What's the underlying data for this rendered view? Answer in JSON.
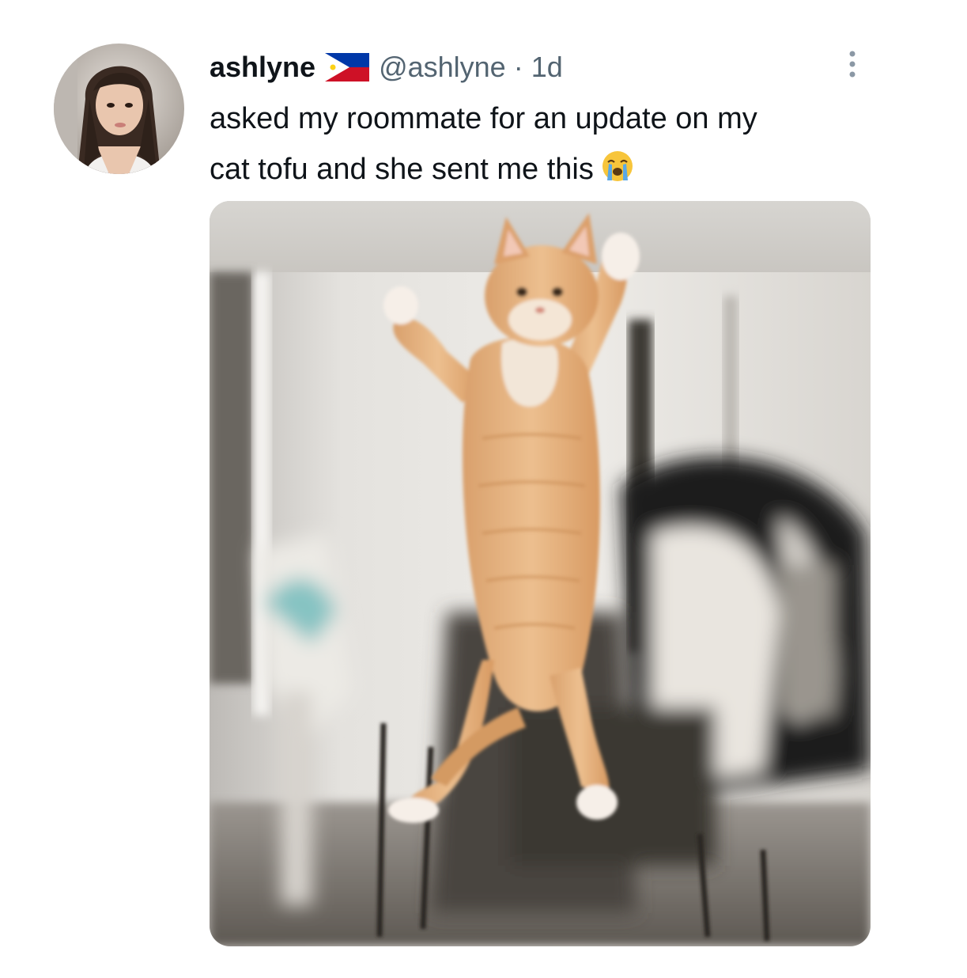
{
  "tweet": {
    "display_name": "ashlyne",
    "handle": "@ashlyne",
    "separator": "·",
    "timestamp": "1d",
    "text_line_1": "asked my roommate for an update on my",
    "text_line_2": "cat tofu and she sent me this",
    "flag_icon": "philippines-flag-icon",
    "emoji_icon": "loudly-crying-face-icon",
    "more_icon": "more-options-icon"
  },
  "colors": {
    "text_primary": "#0f1419",
    "text_secondary": "#536471",
    "background": "#ffffff"
  }
}
